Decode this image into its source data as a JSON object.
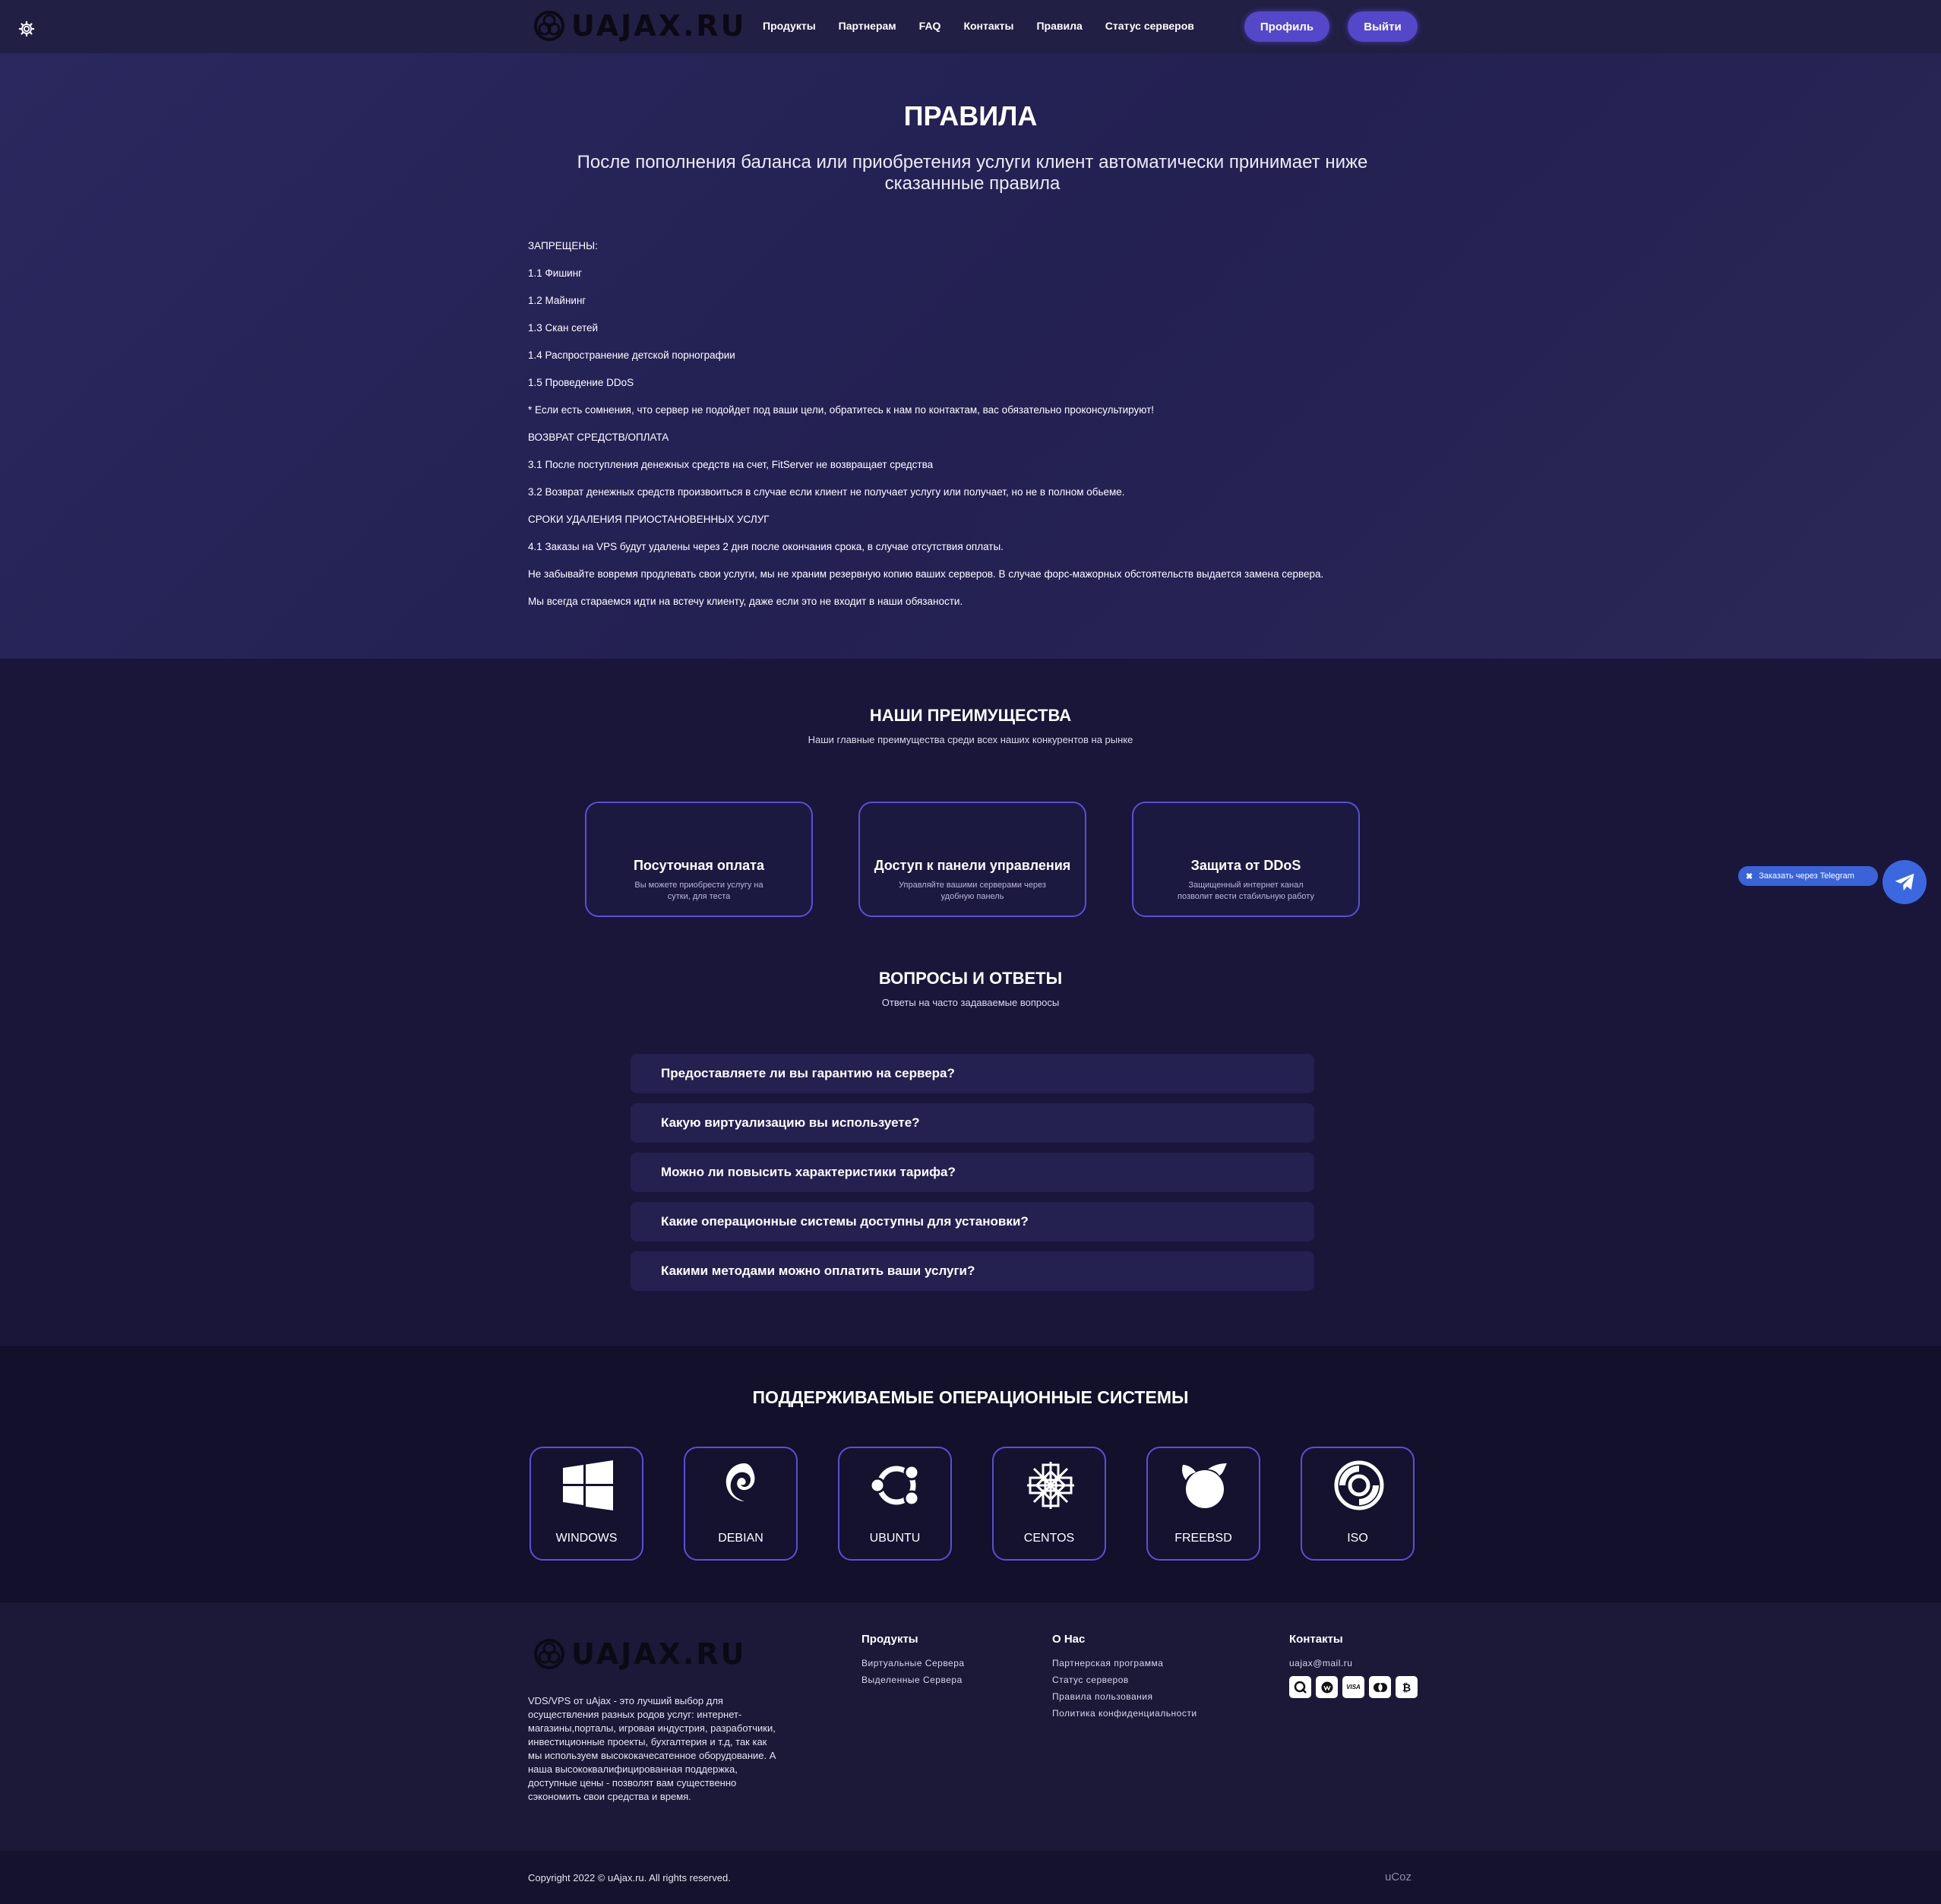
{
  "header": {
    "logo_text": "UAJAX.RU",
    "nav": [
      "Продукты",
      "Партнерам",
      "FAQ",
      "Контакты",
      "Правила",
      "Статус серверов"
    ],
    "profile_label": "Профиль",
    "exit_label": "Выйти"
  },
  "rules": {
    "title": "ПРАВИЛА",
    "subtitle": "После пополнения баланса или приобретения услуги клиент автоматически принимает ниже сказаннные правила",
    "lines": [
      "ЗАПРЕЩЕНЫ:",
      "1.1 Фишинг",
      "1.2 Майнинг",
      "1.3 Скан сетей",
      "1.4 Распространение детской порнографии",
      "1.5 Проведение DDoS",
      "* Если есть сомнения, что сервер не подойдет под ваши цели, обратитесь к нам по контактам, вас обязательно проконсультируют!",
      "ВОЗВРАТ СРЕДСТВ/ОПЛАТА",
      "3.1 После поступления денежных средств на счет, FitServer не возвращает средства",
      "3.2 Возврат денежных средств произвоиться в случае если клиент не получает услугу или получает, но не в полном обьеме.",
      "СРОКИ УДАЛЕНИЯ ПРИОСТАНОВЕННЫХ УСЛУГ",
      "4.1 Заказы на VPS будут удалены через 2 дня после окончания срока, в случае отсутствия оплаты.",
      "Не забывайте вовремя продлевать свои услуги, мы не храним резервную копию ваших серверов. В случае форс-мажорных обстоятельств выдается замена сервера.",
      "Мы всегда стараемся идти на встечу клиенту, даже если это не входит в наши обязаности."
    ]
  },
  "advantages": {
    "title": "НАШИ ПРЕИМУЩЕСТВА",
    "subtitle": "Наши главные преимущества среди всех наших конкурентов на рынке",
    "cards": [
      {
        "title": "Посуточная оплата",
        "text": "Вы можете приобрести услугу на сутки, для теста"
      },
      {
        "title": "Доступ к панели управления",
        "text": "Управляйте вашими серверами через удобную панель"
      },
      {
        "title": "Защита от DDoS",
        "text": "Защищенный интернет канал позволит вести стабильную работу"
      }
    ]
  },
  "faq": {
    "title": "ВОПРОСЫ И ОТВЕТЫ",
    "subtitle": "Ответы на часто задаваемые вопросы",
    "items": [
      "Предоставляете ли вы гарантию на сервера?",
      "Какую виртуализацию вы используете?",
      "Можно ли повысить характеристики тарифа?",
      "Какие операционные системы доступны для установки?",
      "Какими методами можно оплатить ваши услуги?"
    ]
  },
  "telegram": {
    "label": "Заказать через Telegram",
    "icon": "paper-plane-icon",
    "color": "#3b68e0"
  },
  "os": {
    "title": "ПОДДЕРЖИВАЕМЫЕ ОПЕРАЦИОННЫЕ СИСТЕМЫ",
    "items": [
      {
        "label": "WINDOWS",
        "icon": "windows-icon"
      },
      {
        "label": "DEBIAN",
        "icon": "debian-icon"
      },
      {
        "label": "UBUNTU",
        "icon": "ubuntu-icon"
      },
      {
        "label": "CENTOS",
        "icon": "centos-icon"
      },
      {
        "label": "FREEBSD",
        "icon": "freebsd-icon"
      },
      {
        "label": "ISO",
        "icon": "disc-icon"
      }
    ]
  },
  "footer": {
    "logo_text": "UAJAX.RU",
    "description": "VDS/VPS от uAjax - это лучший выбор для осуществления разных родов услуг: интернет-магазины,порталы, игровая индустрия, разработчики, инвестиционные проекты, бухгалтерия и т.д, так как мы используем высококачесатенное оборудование. А наша высококвалифицированная поддержка, доступные цены - позволят вам существенно сэкономить свои средства и время.",
    "products": {
      "title": "Продукты",
      "links": [
        "Виртуальные Сервера",
        "Выделенные Сервера"
      ]
    },
    "about": {
      "title": "О Нас",
      "links": [
        "Партнерская программа",
        "Статус серверов",
        "Правила пользования",
        "Политика конфиденциальности"
      ]
    },
    "contacts": {
      "title": "Контакты",
      "email": "uajax@mail.ru",
      "payment_icons": [
        "qiwi-icon",
        "webmoney-icon",
        "visa-icon",
        "mastercard-icon",
        "bitcoin-icon"
      ]
    },
    "copyright": "Copyright 2022 © uAjax.ru. All rights reserved.",
    "ucoz": "uCoz"
  },
  "colors": {
    "accent": "#5547c9",
    "card_border": "#5a4fd8",
    "background": "#1a1838"
  }
}
